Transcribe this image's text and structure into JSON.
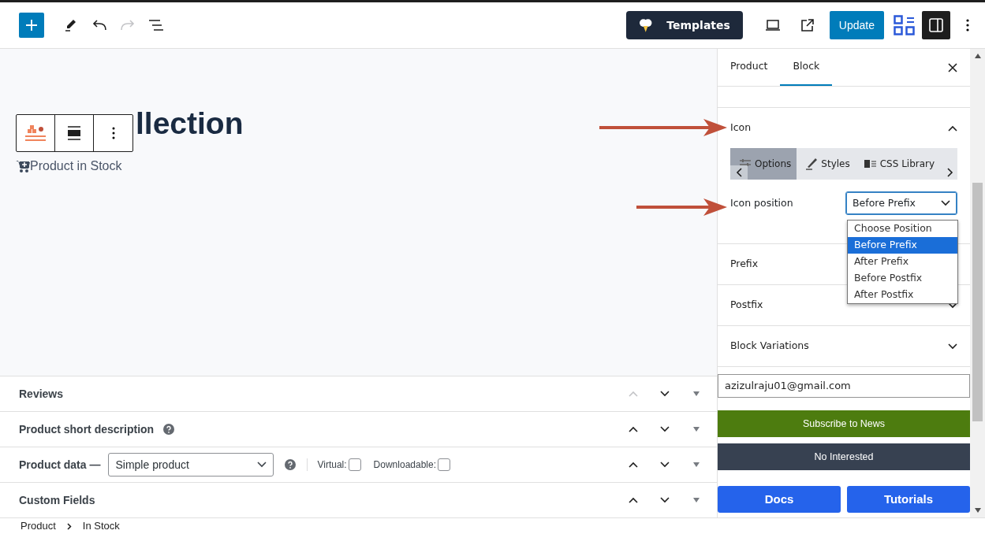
{
  "toolbar": {
    "templates_button": "Templates",
    "update_button": "Update",
    "redo_disabled": true
  },
  "editor": {
    "title": "llection",
    "stock_label": "Product in Stock"
  },
  "metaboxes": [
    {
      "kind": "plain",
      "title": "Reviews",
      "help": false,
      "up_disabled": true
    },
    {
      "kind": "plain",
      "title": "Product short description",
      "help": true,
      "up_disabled": false
    },
    {
      "kind": "product_data",
      "title": "Product data —",
      "select": "Simple product",
      "help": true,
      "up_disabled": false,
      "checks": [
        {
          "label": "Virtual:",
          "checked": false
        },
        {
          "label": "Downloadable:",
          "checked": false
        }
      ]
    },
    {
      "kind": "plain",
      "title": "Custom Fields",
      "help": false,
      "up_disabled": false
    }
  ],
  "breadcrumb": [
    "Product",
    "In Stock"
  ],
  "sidebar": {
    "tabs": [
      {
        "label": "Product",
        "selected": false
      },
      {
        "label": "Block",
        "selected": true
      }
    ],
    "sections": [
      {
        "title": "Icon",
        "expanded": true
      },
      {
        "title": "Prefix"
      },
      {
        "title": "Postfix",
        "expanded": false
      },
      {
        "title": "Block Variations",
        "expanded": false
      }
    ],
    "option_tabs": [
      {
        "label": "Options",
        "selected": true
      },
      {
        "label": "Styles",
        "selected": false
      },
      {
        "label": "CSS Library",
        "selected": false
      }
    ],
    "icon_position": {
      "label": "Icon position",
      "value": "Before Prefix",
      "options": [
        {
          "label": "Choose Position",
          "selected": false
        },
        {
          "label": "Before Prefix",
          "selected": true
        },
        {
          "label": "After Prefix",
          "selected": false
        },
        {
          "label": "Before Postfix",
          "selected": false
        },
        {
          "label": "After Postfix",
          "selected": false
        }
      ]
    },
    "email": "azizulraju01@gmail.com",
    "subscribe_button": "Subscribe to News",
    "decline_button": "No Interested",
    "links": [
      "Docs",
      "Tutorials"
    ]
  }
}
